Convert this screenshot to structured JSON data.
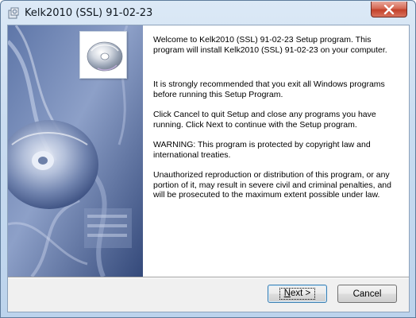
{
  "window": {
    "title": "Kelk2010 (SSL) 91-02-23",
    "app_icon": "installer-icon",
    "close_icon": "close-icon"
  },
  "side_panel": {
    "logo_icon": "cd-disc-icon",
    "background": "blue-cd-and-cables-artwork",
    "colors": {
      "dark": "#2a3f6e",
      "mid": "#7388b2",
      "light": "#c2cee6"
    }
  },
  "body": {
    "paragraphs": [
      "Welcome to Kelk2010 (SSL) 91-02-23 Setup program. This program will install Kelk2010 (SSL) 91-02-23 on your computer.",
      "It is strongly recommended that you exit all Windows programs before running this Setup Program.",
      "Click Cancel to quit Setup and close any programs you have running.  Click Next to continue with the Setup program.",
      "WARNING: This program is protected by copyright law and international treaties.",
      "Unauthorized reproduction or distribution of this program, or any portion of it, may result in severe civil and criminal penalties, and will be prosecuted to the maximum extent possible under law."
    ]
  },
  "buttons": {
    "next_mnemonic": "N",
    "next_rest": "ext >",
    "cancel": "Cancel"
  }
}
